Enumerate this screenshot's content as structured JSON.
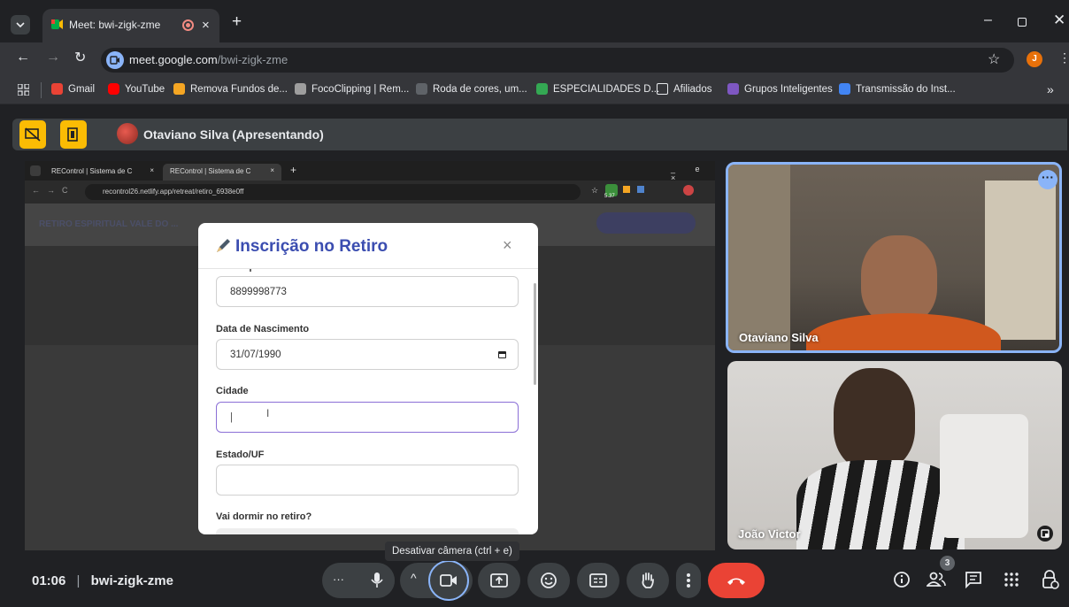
{
  "browser": {
    "tab_title": "Meet: bwi-zigk-zme",
    "url_host": "meet.google.com",
    "url_path": "/bwi-zigk-zme",
    "bookmarks": [
      {
        "label": "Gmail",
        "color": "#ea4335"
      },
      {
        "label": "YouTube",
        "color": "#ff0000"
      },
      {
        "label": "Remova Fundos de...",
        "color": "#f5a623"
      },
      {
        "label": "FocoClipping | Rem...",
        "color": "#9e9e9e"
      },
      {
        "label": "Roda de cores, um...",
        "color": "#5f6368"
      },
      {
        "label": "ESPECIALIDADES D...",
        "color": "#34a853"
      },
      {
        "label": "Afiliados",
        "color": "#e8eaed"
      },
      {
        "label": "Grupos Inteligentes",
        "color": "#7e57c2"
      },
      {
        "label": "Transmissão do Inst...",
        "color": "#4285f4"
      }
    ],
    "profile_initial": "J"
  },
  "presenting": {
    "label": "Otaviano Silva (Apresentando)"
  },
  "shared_screen": {
    "tabs": [
      "REControl | Sistema de C",
      "REControl | Sistema de C"
    ],
    "url": "recontrol26.netlify.app/retreat/retiro_6938e0ff",
    "extension_badge": "5.37",
    "page_heading": "RETIRO ESPIRITUAL VALE DO ..."
  },
  "modal": {
    "title": "Inscrição no Retiro",
    "close": "×",
    "phone_value": "8899998773",
    "fields": {
      "birth_label": "Data de Nascimento",
      "birth_value": "31/07/1990",
      "city_label": "Cidade",
      "city_value": "|",
      "state_label": "Estado/UF",
      "state_value": "",
      "sleep_label": "Vai dormir no retiro?"
    }
  },
  "participants": [
    {
      "name": "Otaviano Silva"
    },
    {
      "name": "João Victor"
    }
  ],
  "bottom_bar": {
    "time": "01:06",
    "separator": "|",
    "meeting_code": "bwi-zigk-zme",
    "tooltip": "Desativar câmera (ctrl + e)",
    "participant_count": "3"
  },
  "colors": {
    "accent": "#8ab4f8",
    "hangup": "#ea4335",
    "present_yellow": "#fbbc04",
    "tile_border": "#8ab4f8"
  }
}
